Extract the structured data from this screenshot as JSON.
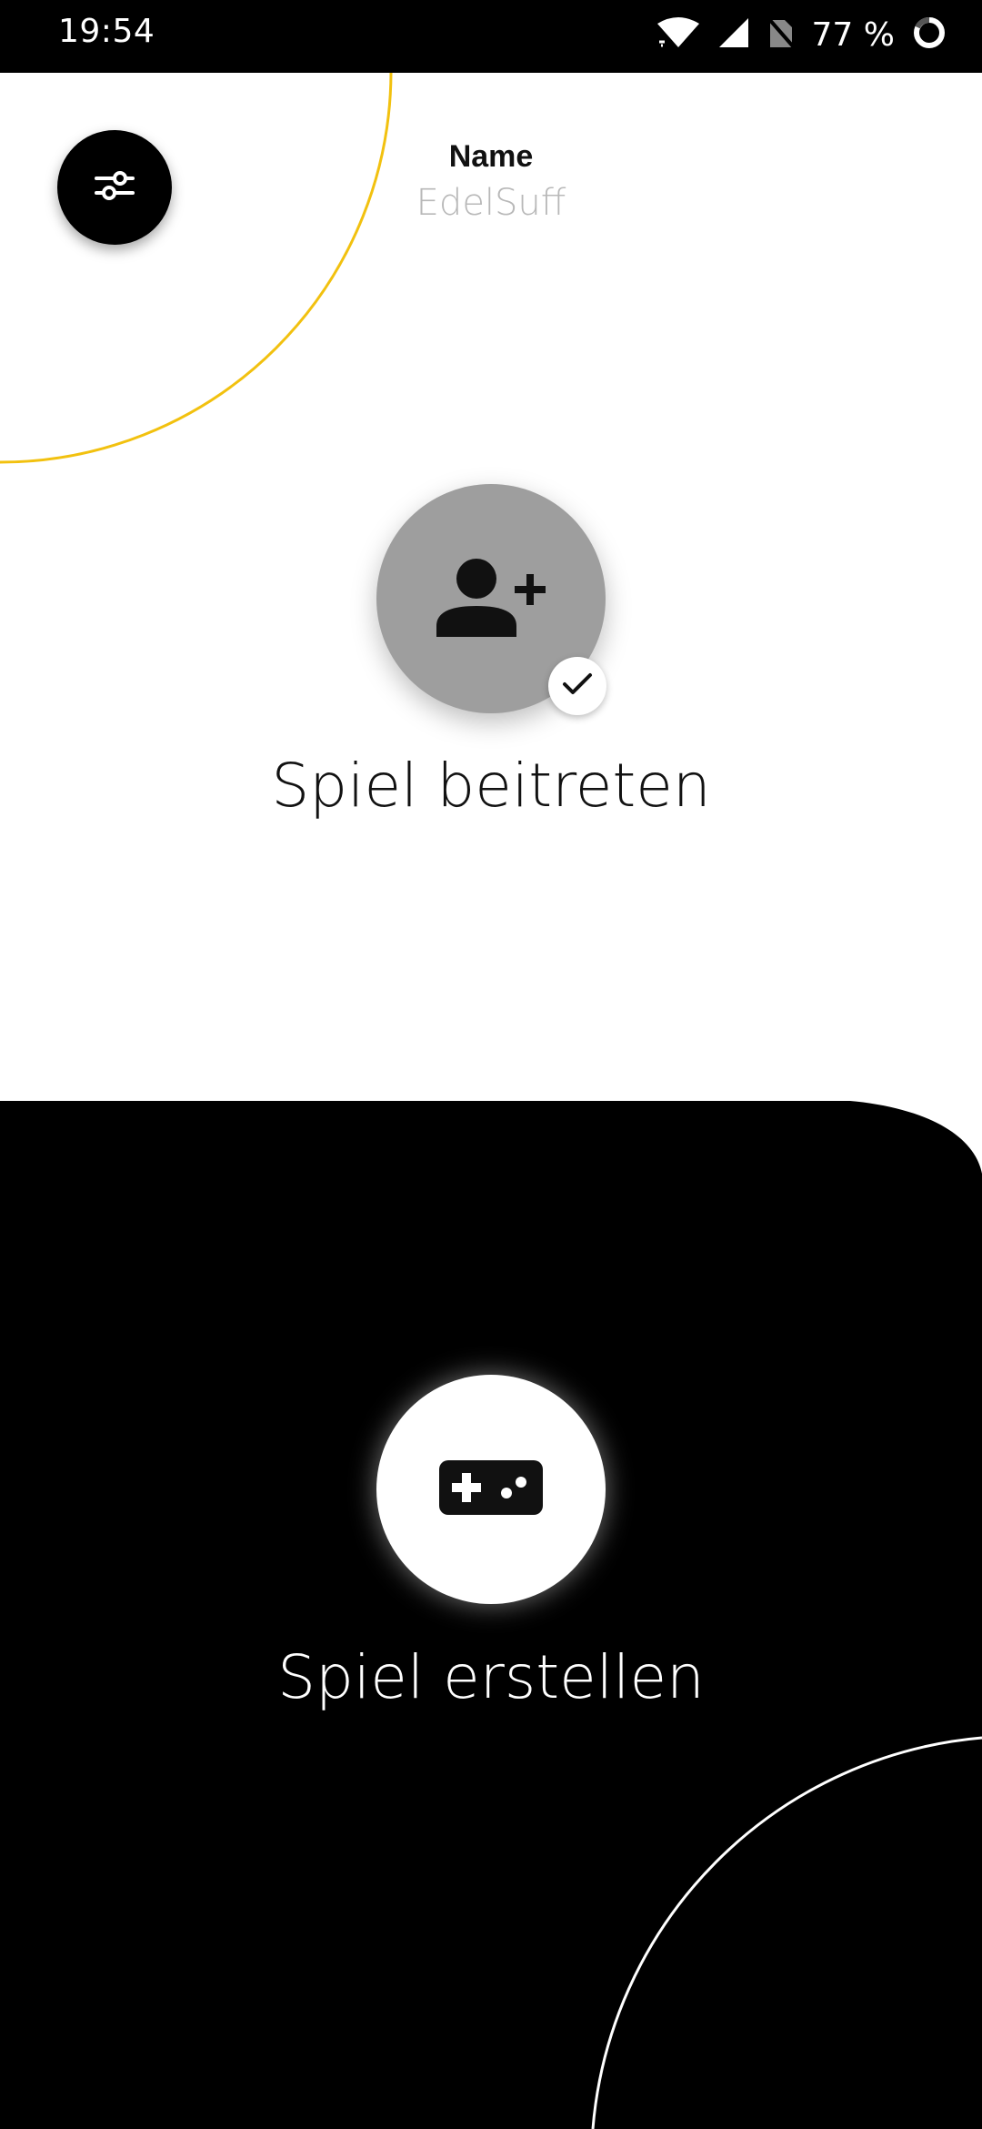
{
  "status_bar": {
    "time": "19:54",
    "battery_text": "77 %",
    "icons": [
      "wifi-icon",
      "signal-icon",
      "no-sim-icon",
      "battery-ring-icon"
    ]
  },
  "header": {
    "settings_icon": "sliders-icon",
    "name_label": "Name",
    "name_value": "EdelSuff"
  },
  "join": {
    "icon": "person-add-icon",
    "badge_icon": "check-icon",
    "label": "Spiel beitreten"
  },
  "create": {
    "icon": "gamepad-icon",
    "label": "Spiel erstellen"
  },
  "colors": {
    "accent_yellow": "#F2C10F",
    "join_button_bg": "#9E9E9E",
    "background_dark": "#000000",
    "background_light": "#FFFFFF"
  }
}
